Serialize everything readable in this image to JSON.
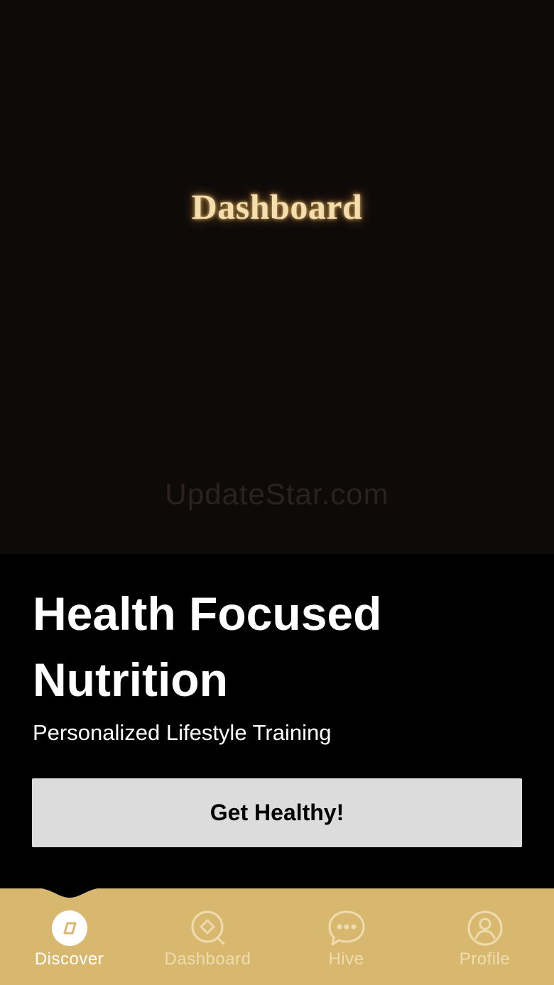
{
  "hero": {
    "title": "Dashboard",
    "watermark": "UpdateStar.com"
  },
  "content": {
    "headline_line1": "Health Focused",
    "headline_line2": "Nutrition",
    "subtitle": "Personalized Lifestyle Training",
    "cta_label": "Get Healthy!"
  },
  "nav": {
    "items": [
      {
        "label": "Discover",
        "icon": "compass-icon",
        "active": true
      },
      {
        "label": "Dashboard",
        "icon": "dashboard-icon",
        "active": false
      },
      {
        "label": "Hive",
        "icon": "chat-bubble-icon",
        "active": false
      },
      {
        "label": "Profile",
        "icon": "profile-icon",
        "active": false
      }
    ]
  },
  "colors": {
    "nav_background": "#d8b86e",
    "hero_background": "#0f0a0a",
    "button_background": "#dcdcdc",
    "glow_text": "#f4deb0"
  }
}
